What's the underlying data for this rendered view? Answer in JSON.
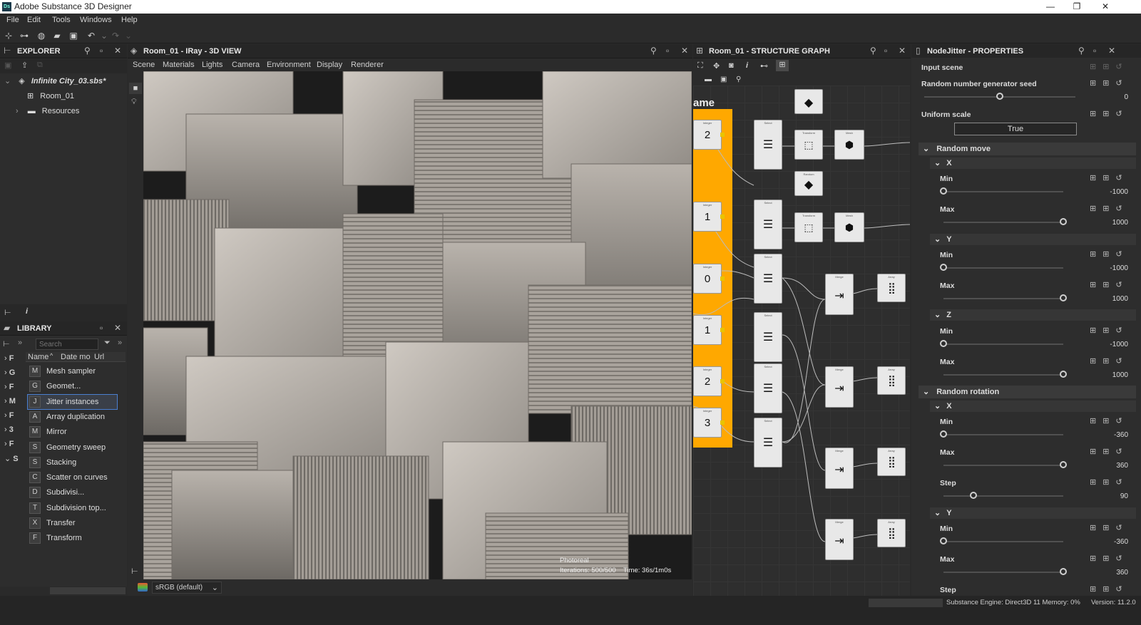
{
  "app": {
    "title": "Adobe Substance 3D Designer",
    "logo": "Ds"
  },
  "menu": [
    "File",
    "Edit",
    "Tools",
    "Windows",
    "Help"
  ],
  "explorer": {
    "title": "EXPLORER",
    "package": "Infinite City_03.sbs*",
    "graph": "Room_01",
    "folder": "Resources"
  },
  "viewport": {
    "title": "Room_01 - IRay - 3D VIEW",
    "tabs": [
      "Scene",
      "Materials",
      "Lights",
      "Camera",
      "Environment",
      "Display",
      "Renderer"
    ],
    "mode": "Photoreal",
    "iterations": "Iterations: 500/500",
    "time": "Time: 36s/1m0s",
    "colorspace": "sRGB (default)"
  },
  "library": {
    "title": "LIBRARY",
    "search_placeholder": "Search",
    "col_name": "Name",
    "col_date": "Date mo",
    "col_url": "Url",
    "left_letters": [
      "F",
      "G",
      "F",
      "M",
      "F",
      "3",
      "F",
      "S"
    ],
    "items": [
      {
        "label": "Mesh sampler",
        "icon": "M"
      },
      {
        "label": "Geomet...",
        "icon": "G"
      },
      {
        "label": "Jitter instances",
        "icon": "J"
      },
      {
        "label": "Array duplication",
        "icon": "A"
      },
      {
        "label": "Mirror",
        "icon": "M"
      },
      {
        "label": "Geometry sweep",
        "icon": "S"
      },
      {
        "label": "Stacking",
        "icon": "S"
      },
      {
        "label": "Scatter on curves",
        "icon": "C"
      },
      {
        "label": "Subdivisi...",
        "icon": "D"
      },
      {
        "label": "Subdivision top...",
        "icon": "T"
      },
      {
        "label": "Transfer",
        "icon": "X"
      },
      {
        "label": "Transform",
        "icon": "F"
      }
    ],
    "selected": 2
  },
  "graph": {
    "title": "Room_01 - STRUCTURE GRAPH",
    "frame_label": "ame",
    "numbers": [
      "2",
      "1",
      "0",
      "1",
      "2",
      "3"
    ]
  },
  "props": {
    "title": "NodeJitter - PROPERTIES",
    "input_scene": "Input scene",
    "seed_label": "Random number generator seed",
    "seed_value": "0",
    "seed_fraction": 0.5,
    "uniform_label": "Uniform scale",
    "uniform_value": "True",
    "random_move": "Random move",
    "random_rotation": "Random rotation",
    "x": "X",
    "y": "Y",
    "z": "Z",
    "min": "Min",
    "max": "Max",
    "step": "Step",
    "move_x_min": "-1000",
    "move_x_max": "1000",
    "move_y_min": "-1000",
    "move_y_max": "1000",
    "move_z_min": "-1000",
    "move_z_max": "1000",
    "rot_x_min": "-360",
    "rot_x_max": "360",
    "rot_x_step": "90",
    "rot_y_min": "-360",
    "rot_y_max": "360"
  },
  "status": {
    "engine": "Substance Engine: Direct3D 11 Memory: 0%",
    "version": "Version: 11.2.0"
  },
  "colors": {
    "accent": "#ffa800",
    "selection": "#4a7fd0"
  }
}
